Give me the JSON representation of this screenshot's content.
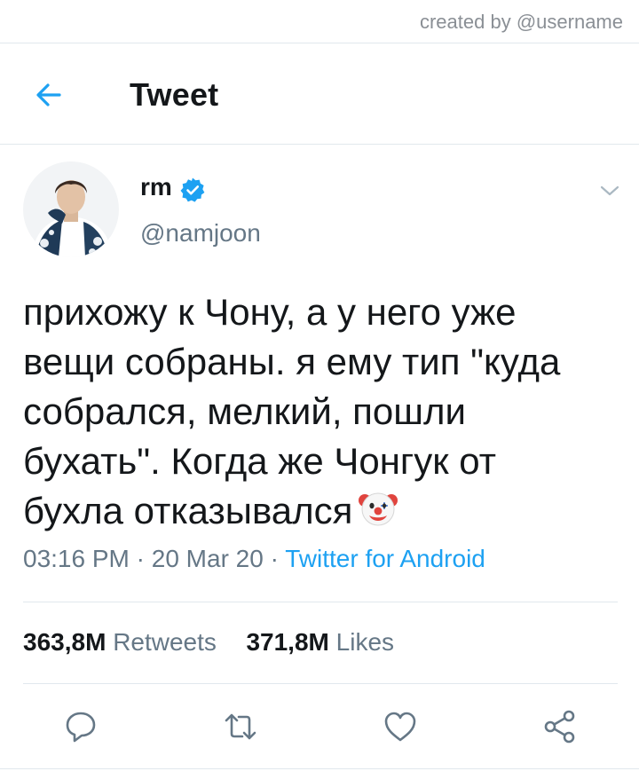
{
  "watermark": "created by @username",
  "header": {
    "title": "Tweet"
  },
  "author": {
    "name": "rm",
    "handle": "@namjoon",
    "verified": true
  },
  "tweet": {
    "text": "прихожу к Чону, а у него уже\nвещи собраны. я ему тип \"куда\nсобрался, мелкий, пошли\nбухать\". Когда же Чонгук от\nбухла отказывался",
    "time": "03:16 PM",
    "date": "20 Mar 20",
    "source": "Twitter for Android"
  },
  "stats": {
    "retweets_count": "363,8M",
    "retweets_label": "Retweets",
    "likes_count": "371,8M",
    "likes_label": "Likes"
  },
  "colors": {
    "accent": "#1da1f2",
    "muted": "#657786",
    "text": "#14171a",
    "divider": "#e1e8ed"
  },
  "icons": [
    "back-arrow-icon",
    "verified-badge-icon",
    "chevron-down-icon",
    "clown-emoji-icon",
    "reply-icon",
    "retweet-icon",
    "like-icon",
    "share-icon"
  ]
}
